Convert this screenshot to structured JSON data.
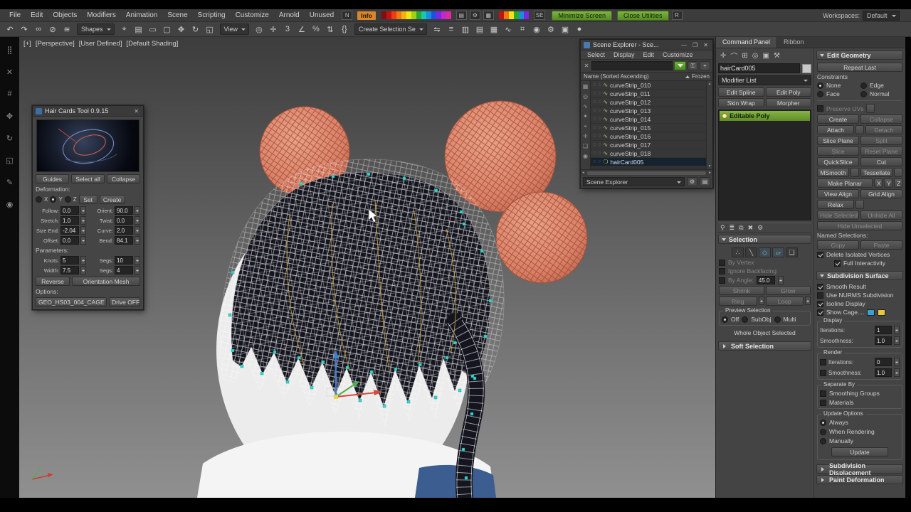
{
  "menubar": {
    "items": [
      "File",
      "Edit",
      "Objects",
      "Modifiers",
      "Animation",
      "Scene",
      "Scripting",
      "Customize",
      "Arnold",
      "Unused"
    ],
    "n_button": "N",
    "info_badge": "Info",
    "se_label": "SE",
    "r_button": "R",
    "minimize_screen": "Minimize Screen",
    "close_utilities": "Close Utilities",
    "workspaces_label": "Workspaces:",
    "workspaces_value": "Default",
    "swatches": [
      "#7f1010",
      "#c41212",
      "#f03c10",
      "#f07a10",
      "#f0b410",
      "#f0e610",
      "#9cd414",
      "#2ca82c",
      "#14c8b4",
      "#1490e0",
      "#2050e0",
      "#7a28e0",
      "#c028d0",
      "#e028a0"
    ],
    "tool_icons": [
      {
        "name": "layers-icon",
        "glyph": "▤"
      },
      {
        "name": "settings-icon",
        "glyph": "⚙"
      },
      {
        "name": "grid-box-icon",
        "glyph": "▦"
      }
    ],
    "swatches2": [
      "#c41212",
      "#f07a10",
      "#f0e610",
      "#2ca82c",
      "#1490e0",
      "#7a28e0"
    ]
  },
  "toolbar": {
    "icons_a": [
      {
        "name": "undo-icon",
        "glyph": "↶"
      },
      {
        "name": "redo-icon",
        "glyph": "↷"
      },
      {
        "name": "select-and-link-icon",
        "glyph": "∞"
      },
      {
        "name": "unlink-selection-icon",
        "glyph": "⊘"
      },
      {
        "name": "bind-to-space-warp-icon",
        "glyph": "≋"
      }
    ],
    "shapes_dropdown": "Shapes",
    "icons_b": [
      {
        "name": "select-object-icon",
        "glyph": "⌖"
      },
      {
        "name": "select-by-name-icon",
        "glyph": "▤"
      },
      {
        "name": "rectangular-selection-icon",
        "glyph": "▭"
      },
      {
        "name": "window-crossing-icon",
        "glyph": "▢"
      },
      {
        "name": "select-and-move-icon",
        "glyph": "✥"
      },
      {
        "name": "select-and-rotate-icon",
        "glyph": "↻"
      },
      {
        "name": "select-and-scale-icon",
        "glyph": "◱"
      }
    ],
    "view_dropdown": "View",
    "icons_c": [
      {
        "name": "use-pivot-center-icon",
        "glyph": "◎"
      },
      {
        "name": "select-and-manipulate-icon",
        "glyph": "✛"
      },
      {
        "name": "snaps-toggle-icon",
        "glyph": "3"
      },
      {
        "name": "angle-snap-icon",
        "glyph": "∠"
      },
      {
        "name": "percent-snap-icon",
        "glyph": "%"
      },
      {
        "name": "spinner-snap-icon",
        "glyph": "⇅"
      },
      {
        "name": "named-selection-sets-icon",
        "glyph": "{}"
      }
    ],
    "selection_set_dropdown": "Create Selection Se",
    "icons_d": [
      {
        "name": "mirror-icon",
        "glyph": "⇋"
      },
      {
        "name": "align-icon",
        "glyph": "≡"
      },
      {
        "name": "scene-explorer-toggle-icon",
        "glyph": "▥"
      },
      {
        "name": "layer-explorer-toggle-icon",
        "glyph": "▤"
      },
      {
        "name": "ribbon-toggle-icon",
        "glyph": "▦"
      },
      {
        "name": "curve-editor-icon",
        "glyph": "∿"
      },
      {
        "name": "schematic-view-icon",
        "glyph": "⌗"
      },
      {
        "name": "material-editor-icon",
        "glyph": "◉"
      },
      {
        "name": "render-setup-icon",
        "glyph": "⚙"
      },
      {
        "name": "rendered-frame-icon",
        "glyph": "▣"
      },
      {
        "name": "render-production-icon",
        "glyph": "●"
      }
    ]
  },
  "left_strip": {
    "icons": [
      {
        "name": "grid-snap-icon",
        "glyph": "⣿"
      },
      {
        "name": "close-tool-icon",
        "glyph": "✕"
      },
      {
        "name": "hash-tool-icon",
        "glyph": "#"
      },
      {
        "name": "move-tool-icon",
        "glyph": "✥"
      },
      {
        "name": "rotate-tool-icon",
        "glyph": "↻"
      },
      {
        "name": "scale-tool-icon",
        "glyph": "◱"
      },
      {
        "name": "draw-tool-icon",
        "glyph": "✎"
      },
      {
        "name": "target-tool-icon",
        "glyph": "◉"
      }
    ]
  },
  "viewport": {
    "label_parts": [
      "[+]",
      "[Perspective]",
      "[User Defined]",
      "[Default Shading]"
    ]
  },
  "hair_tool": {
    "title": "Hair Cards Tool 0.9.15",
    "buttons_top": [
      "Guides",
      "Select all",
      "Collapse"
    ],
    "deformation_label": "Deformation:",
    "axes": [
      "X",
      "Y",
      "Z"
    ],
    "set_button": "Set",
    "create_button": "Create",
    "fields": [
      {
        "label": "Follow:",
        "value": "0.0"
      },
      {
        "label": "Orient:",
        "value": "90.0"
      },
      {
        "label": "Stretch:",
        "value": "1.0"
      },
      {
        "label": "Twist:",
        "value": "0.0"
      },
      {
        "label": "Size End:",
        "value": "-2.04"
      },
      {
        "label": "Curve:",
        "value": "2.0"
      },
      {
        "label": "Offset:",
        "value": "0.0"
      },
      {
        "label": "Bend:",
        "value": "84.1"
      }
    ],
    "parameters_label": "Parameters:",
    "param_fields": [
      {
        "label": "Knots:",
        "value": "5"
      },
      {
        "label": "Segs:",
        "value": "10"
      },
      {
        "label": "Width:",
        "value": "7.5"
      },
      {
        "label": "Segs:",
        "value": "4"
      }
    ],
    "reverse_button": "Reverse",
    "orientation_button": "Orientation Mesh",
    "options_label": "Options:",
    "cage_button": "GEO_HS03_004_CAGE",
    "drive_button": "Drive OFF"
  },
  "scene_explorer": {
    "title": "Scene Explorer - Sce...",
    "title_buttons": [
      {
        "name": "minimize-icon",
        "glyph": "—"
      },
      {
        "name": "restore-icon",
        "glyph": "❐"
      },
      {
        "name": "close-icon",
        "glyph": "✕"
      }
    ],
    "menus": [
      "Select",
      "Display",
      "Edit",
      "Customize"
    ],
    "clear_glyph": "✕",
    "add_glyph": "+",
    "lock_glyph": "⚿",
    "header_name": "Name (Sorted Ascending)",
    "header_frozen": "Frozen",
    "side_icons": [
      {
        "name": "display-all-icon",
        "glyph": "▦"
      },
      {
        "name": "display-geometry-icon",
        "glyph": "◎"
      },
      {
        "name": "display-shapes-icon",
        "glyph": "∿"
      },
      {
        "name": "display-lights-icon",
        "glyph": "✦"
      },
      {
        "name": "display-cameras-icon",
        "glyph": "⌖"
      },
      {
        "name": "display-helpers-icon",
        "glyph": "✛"
      },
      {
        "name": "display-groups-icon",
        "glyph": "❏"
      },
      {
        "name": "display-materials-icon",
        "glyph": "◉"
      }
    ],
    "row_toggle_glyph": "◌",
    "row_type_glyph": "∿",
    "selected_type_glyph": "❍",
    "rows": [
      "curveStrip_010",
      "curveStrip_011",
      "curveStrip_012",
      "curveStrip_013",
      "curveStrip_014",
      "curveStrip_015",
      "curveStrip_016",
      "curveStrip_017",
      "curveStrip_018"
    ],
    "selected_row": "hairCard005",
    "bottom_dropdown": "Scene Explorer"
  },
  "command_panel": {
    "tabs": [
      "Command Panel",
      "Ribbon"
    ],
    "panel_icons": [
      {
        "name": "create-tab-icon",
        "glyph": "✛"
      },
      {
        "name": "modify-tab-icon",
        "glyph": "⌒"
      },
      {
        "name": "hierarchy-tab-icon",
        "glyph": "⊞"
      },
      {
        "name": "motion-tab-icon",
        "glyph": "◎"
      },
      {
        "name": "display-tab-icon",
        "glyph": "▣"
      },
      {
        "name": "utilities-tab-icon",
        "glyph": "⚒"
      }
    ],
    "object_name": "hairCard005",
    "modifier_list_label": "Modifier List",
    "modifier_buttons": [
      "Edit Spline",
      "Edit Poly",
      "Skin Wrap",
      "Morpher"
    ],
    "stack_item": "Editable Poly",
    "stack_icons": [
      {
        "name": "pin-stack-icon",
        "glyph": "⚲"
      },
      {
        "name": "show-end-result-icon",
        "glyph": "≣"
      },
      {
        "name": "make-unique-icon",
        "glyph": "⧉"
      },
      {
        "name": "remove-modifier-icon",
        "glyph": "✖"
      },
      {
        "name": "configure-modifier-sets-icon",
        "glyph": "⚙"
      }
    ],
    "selection": {
      "title": "Selection",
      "subobject_icons": [
        {
          "name": "vertex-mode-icon",
          "glyph": "∴"
        },
        {
          "name": "edge-mode-icon",
          "glyph": "╲"
        },
        {
          "name": "border-mode-icon",
          "glyph": "◇"
        },
        {
          "name": "polygon-mode-icon",
          "glyph": "▱"
        },
        {
          "name": "element-mode-icon",
          "glyph": "❏"
        }
      ],
      "by_vertex": "By Vertex",
      "ignore_backfacing": "Ignore Backfacing",
      "by_angle_label": "By Angle:",
      "by_angle_value": "45.0",
      "shrink": "Shrink",
      "grow": "Grow",
      "ring": "Ring",
      "loop": "Loop",
      "preview_label": "Preview Selection",
      "preview_options": [
        "Off",
        "SubObj",
        "Multi"
      ],
      "status": "Whole Object Selected"
    },
    "soft_selection_title": "Soft Selection",
    "edit_geometry": {
      "title": "Edit Geometry",
      "repeat_last": "Repeat Last",
      "constraints_label": "Constraints",
      "constraints": [
        "None",
        "Edge",
        "Face",
        "Normal"
      ],
      "preserve_uvs": "Preserve UVs",
      "create": "Create",
      "collapse": "Collapse",
      "attach": "Attach",
      "detach": "Detach",
      "slice_plane": "Slice Plane",
      "split": "Split",
      "slice": "Slice",
      "reset_plane": "Reset Plane",
      "quickslice": "QuickSlice",
      "cut": "Cut",
      "msmooth": "MSmooth",
      "tessellate": "Tessellate",
      "make_planar": "Make Planar",
      "axis_x": "X",
      "axis_y": "Y",
      "axis_z": "Z",
      "view_align": "View Align",
      "grid_align": "Grid Align",
      "relax": "Relax",
      "hide_selected": "Hide Selected",
      "unhide_all": "Unhide All",
      "hide_unselected": "Hide Unselected",
      "named_selections_label": "Named Selections:",
      "copy": "Copy",
      "paste": "Paste",
      "delete_isolated": "Delete Isolated Vertices",
      "full_interactivity": "Full Interactivity"
    },
    "subdivision_surface": {
      "title": "Subdivision Surface",
      "smooth_result": "Smooth Result",
      "use_nurms": "Use NURMS Subdivision",
      "isoline_display": "Isoline Display",
      "show_cage": "Show Cage....",
      "cage_colors": [
        "#3aa0d0",
        "#e8c838"
      ],
      "display_label": "Display",
      "iterations_label": "Iterations:",
      "display_iterations": "1",
      "smoothness_label": "Smoothness:",
      "display_smoothness": "1.0",
      "render_label": "Render",
      "render_iterations": "0",
      "render_smoothness": "1.0",
      "separate_by_label": "Separate By",
      "smoothing_groups": "Smoothing Groups",
      "materials": "Materials",
      "update_options_label": "Update Options",
      "update_always": "Always",
      "update_when_rendering": "When Rendering",
      "update_manually": "Manually",
      "update_button": "Update"
    },
    "subdivision_displacement_title": "Subdivision Displacement",
    "paint_deformation_title": "Paint Deformation"
  }
}
